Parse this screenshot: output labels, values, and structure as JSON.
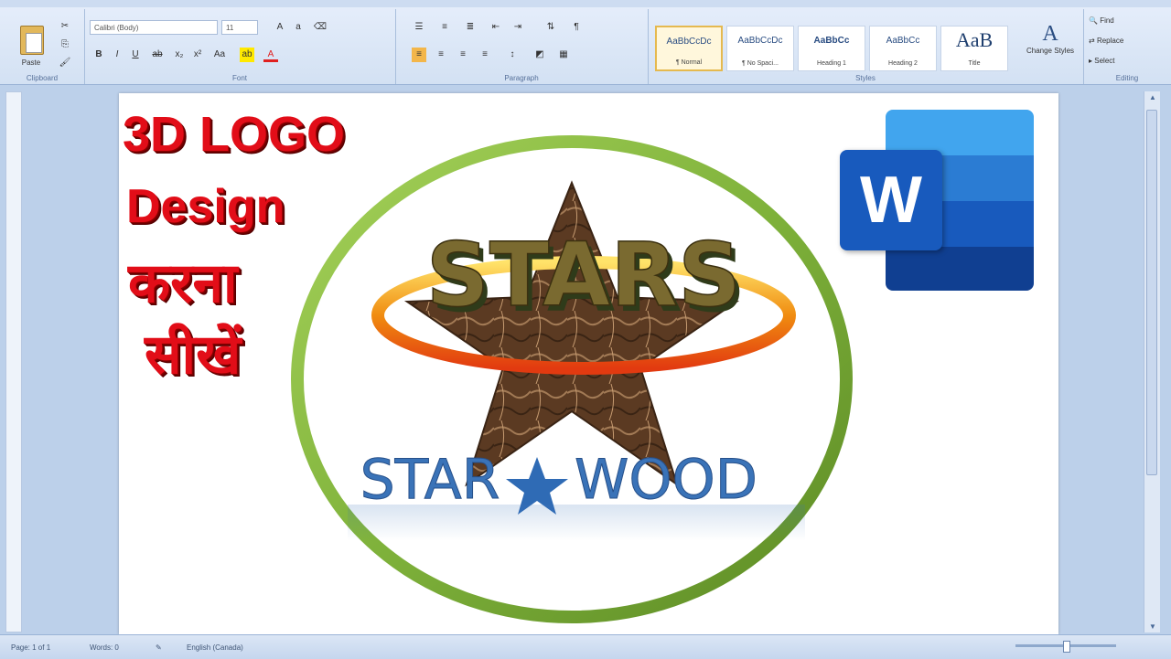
{
  "ribbon": {
    "groups": [
      "Clipboard",
      "Font",
      "Paragraph",
      "Styles",
      "Editing"
    ],
    "paste_label": "Paste",
    "font_name": "Calibri (Body)",
    "font_size": "11",
    "styles": [
      {
        "preview": "AaBbCcDc",
        "name": "¶ Normal"
      },
      {
        "preview": "AaBbCcDc",
        "name": "¶ No Spaci..."
      },
      {
        "preview": "AaBbCc",
        "name": "Heading 1"
      },
      {
        "preview": "AaBbCc",
        "name": "Heading 2"
      },
      {
        "preview": "AaB",
        "name": "Title"
      }
    ],
    "change_styles": "Change Styles",
    "editing": [
      "Find",
      "Replace",
      "Select"
    ]
  },
  "document": {
    "heading_line1": "3D LOGO",
    "heading_line2": "Design",
    "heading_line3": "करना",
    "heading_line4": "सीखें",
    "logo_top_text": "STARS",
    "logo_bottom_left": "STAR",
    "logo_bottom_right": "WOOD",
    "word_logo_letter": "W"
  },
  "statusbar": {
    "page": "Page: 1 of 1",
    "words": "Words: 0",
    "language": "English (Canada)"
  },
  "colors": {
    "heading_red": "#e20d18",
    "ring_green": "#7fb23b",
    "ellipse_orange": "#f2a11e",
    "marble_brown": "#5b3a22",
    "wordmark_blue": "#3a73b8"
  }
}
